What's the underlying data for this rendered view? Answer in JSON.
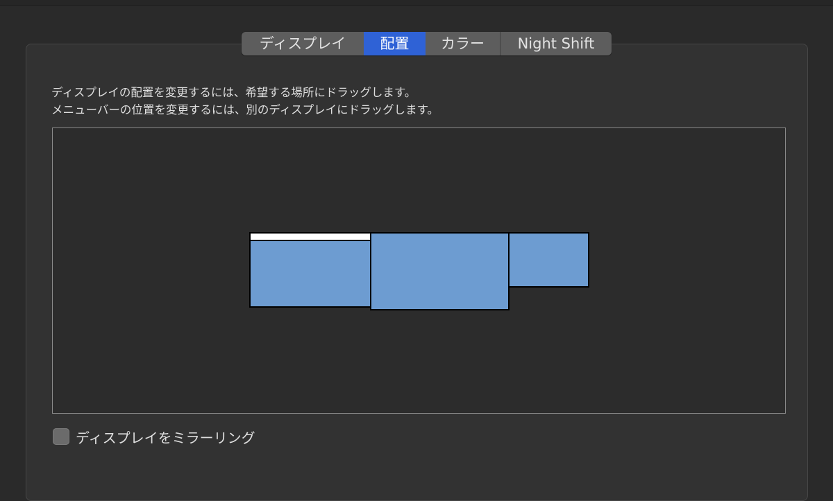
{
  "tabs": [
    {
      "label": "ディスプレイ",
      "active": false
    },
    {
      "label": "配置",
      "active": true
    },
    {
      "label": "カラー",
      "active": false
    },
    {
      "label": "Night Shift",
      "active": false
    }
  ],
  "instructions": {
    "line1": "ディスプレイの配置を変更するには、希望する場所にドラッグします。",
    "line2": "メニューバーの位置を変更するには、別のディスプレイにドラッグします。"
  },
  "displays": [
    {
      "name": "display-1",
      "has_menu_bar": true
    },
    {
      "name": "display-2",
      "has_menu_bar": false
    },
    {
      "name": "display-3",
      "has_menu_bar": false
    }
  ],
  "mirror": {
    "label": "ディスプレイをミラーリング",
    "checked": false
  },
  "colors": {
    "accent": "#2f62d6",
    "display_fill": "#6d9cd1",
    "background": "#323232"
  }
}
